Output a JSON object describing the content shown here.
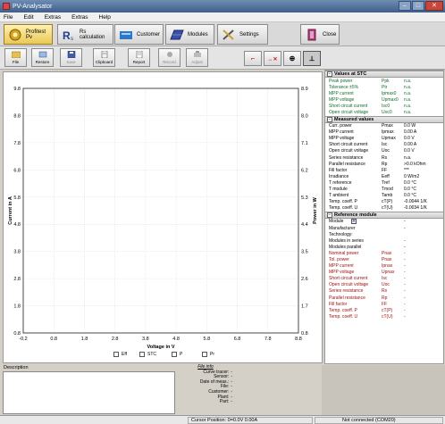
{
  "window": {
    "title": "PV-Analysator"
  },
  "menu": [
    "File",
    "Edit",
    "Extras",
    "Extras",
    "Help"
  ],
  "main_toolbar": {
    "profitest": "Profitest Pv",
    "rs": "Rs calculation",
    "customer": "Customer",
    "modules": "Modules",
    "settings": "Settings",
    "close": "Close"
  },
  "sub_toolbar": {
    "file": "File",
    "restore": "Restore",
    "save": "Save",
    "clipboard": "Clipboard",
    "report": "Report",
    "record": "Record",
    "adjust": "Adjust"
  },
  "chart_data": {
    "type": "line",
    "xlabel": "Voltage in V",
    "ylabel": "Current in A",
    "y2label": "Power in W",
    "xlim": [
      -0.2,
      8.8
    ],
    "ylim": [
      0.8,
      9.8
    ],
    "x_ticks": [
      "-0.2",
      "0.8",
      "1.8",
      "2.8",
      "3.8",
      "4.8",
      "5.8",
      "6.8",
      "7.8",
      "8.8"
    ],
    "y_ticks": [
      "9.8",
      "8.8",
      "7.8",
      "6.8",
      "5.8",
      "4.8",
      "3.8",
      "2.8",
      "1.8",
      "0.8"
    ],
    "y2_ticks": [
      "8.9",
      "8.0",
      "7.1",
      "6.2",
      "5.3",
      "4.4",
      "3.5",
      "2.6",
      "1.7",
      "0.8"
    ],
    "series": []
  },
  "checkboxes": [
    "Eff",
    "STC",
    "P",
    "Pr"
  ],
  "panel": {
    "stc_title": "Values at STC",
    "stc_rows": [
      [
        "Peak power",
        "Ppk",
        "n.a."
      ],
      [
        "Tolerance ±5%",
        "Ptr",
        "n.a."
      ],
      [
        "MPP current",
        "Ipmax0",
        "n.a."
      ],
      [
        "MPP voltage",
        "Upmax0",
        "n.a."
      ],
      [
        "Short circuit current",
        "Isc0",
        "n.a."
      ],
      [
        "Open circuit voltage",
        "Uoc0",
        "n.a."
      ]
    ],
    "measured_title": "Measured values",
    "measured_rows": [
      [
        "Curr. power",
        "Pmax",
        "0.0 W"
      ],
      [
        "MPP current",
        "Ipmax",
        "0.00 A"
      ],
      [
        "MPP voltage",
        "Upmax",
        "0.0 V"
      ],
      [
        "Short circuit current",
        "Isc",
        "0.00 A"
      ],
      [
        "Open circuit voltage",
        "Uoc",
        "0.0 V"
      ],
      [
        "Series resistance",
        "Rs",
        "n.a."
      ],
      [
        "Parallel resistance",
        "Rp",
        ">0.0 kOhm"
      ],
      [
        "Fill factor",
        "FF",
        "***"
      ],
      [
        "Irradiance",
        "Eeff",
        "0 W/m2"
      ],
      [
        "T reference",
        "Tref",
        "0.0 °C"
      ],
      [
        "T module",
        "Tmod",
        "0.0 °C"
      ],
      [
        "T ambient",
        "Tamb",
        "0.0 °C"
      ],
      [
        "Temp. coeff. P",
        "cT(P)",
        "-0.0044 1/K"
      ],
      [
        "Temp. coeff. U",
        "cT(U)",
        "-0.0034 1/K"
      ]
    ],
    "reference_title": "Reference module",
    "ref_plain_rows": [
      [
        "Module",
        "",
        "-"
      ],
      [
        "Manufacturer",
        "",
        "-"
      ],
      [
        "Technology:",
        "",
        ""
      ],
      [
        "Modules in series",
        "",
        "-"
      ],
      [
        "Modules parallel",
        "",
        "-"
      ]
    ],
    "ref_rows": [
      [
        "Nominal power",
        "Pnax",
        "-"
      ],
      [
        "Tol. power",
        "Pnax",
        "-"
      ],
      [
        "MPP current",
        "Ipnax",
        "-"
      ],
      [
        "MPP voltage",
        "Upnax",
        "-"
      ],
      [
        "Short circuit current",
        "Isc",
        "-"
      ],
      [
        "Open circuit voltage",
        "Uoc",
        "-"
      ],
      [
        "Series resistance",
        "Rs",
        "-"
      ],
      [
        "Parallel resistance",
        "Rp",
        "-"
      ],
      [
        "Fill factor",
        "FF",
        "-"
      ],
      [
        "Temp. coeff. P",
        "cT(P)",
        "-"
      ],
      [
        "Temp. coeff. U",
        "cT(U)",
        "-"
      ]
    ]
  },
  "bottom": {
    "description_label": "Description",
    "file_info_header": "File info",
    "file_info": [
      "Curve tracer:",
      "Sensor:",
      "Date of meas.:",
      "File:",
      "Customer:",
      "Plant:",
      "Part:"
    ],
    "file_info_values": [
      "-",
      "-",
      "-",
      "-",
      "-",
      "-",
      "-"
    ]
  },
  "status": {
    "cursor": "Cursor Position: 0=0.0V  0.00A",
    "connection": "Not connected (COM20)"
  }
}
